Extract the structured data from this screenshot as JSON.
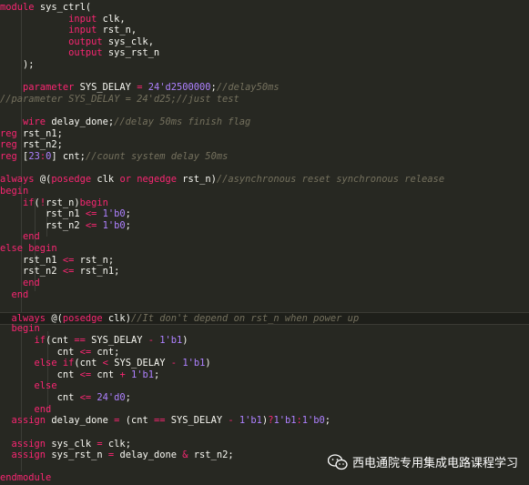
{
  "code_lines": [
    "module sys_ctrl(",
    "            input clk,",
    "            input rst_n,",
    "            output sys_clk,",
    "            output sys_rst_n",
    "    );",
    "",
    "    parameter SYS_DELAY = 24'd2500000;//delay50ms",
    "//parameter SYS_DELAY = 24'd25;//just test",
    "",
    "    wire delay_done;//delay 50ms finish flag",
    "reg rst_n1;",
    "reg rst_n2;",
    "reg [23:0] cnt;//count system delay 50ms",
    "",
    "always @(posedge clk or negedge rst_n)//asynchronous reset synchronous release",
    "begin",
    "    if(!rst_n)begin",
    "        rst_n1 <= 1'b0;",
    "        rst_n2 <= 1'b0;",
    "    end",
    "else begin",
    "    rst_n1 <= rst_n;",
    "    rst_n2 <= rst_n1;",
    "    end",
    "  end",
    "",
    "  always @(posedge clk)//It don't depend on rst_n when power up",
    "  begin",
    "      if(cnt == SYS_DELAY - 1'b1)",
    "          cnt <= cnt;",
    "      else if(cnt < SYS_DELAY - 1'b1)",
    "          cnt <= cnt + 1'b1;",
    "      else",
    "          cnt <= 24'd0;",
    "      end",
    "  assign delay_done = (cnt == SYS_DELAY - 1'b1)?1'b1:1'b0;",
    "",
    "  assign sys_clk = clk;",
    "  assign sys_rst_n = delay_done & rst_n2;",
    "",
    "endmodule"
  ],
  "watermark": {
    "text": "西电通院专用集成电路课程学习",
    "icon": "wechat-icon"
  },
  "colors": {
    "background": "#272822",
    "keyword": "#f92672",
    "comment": "#75715e",
    "number": "#ae81ff",
    "text": "#f8f8f2"
  }
}
